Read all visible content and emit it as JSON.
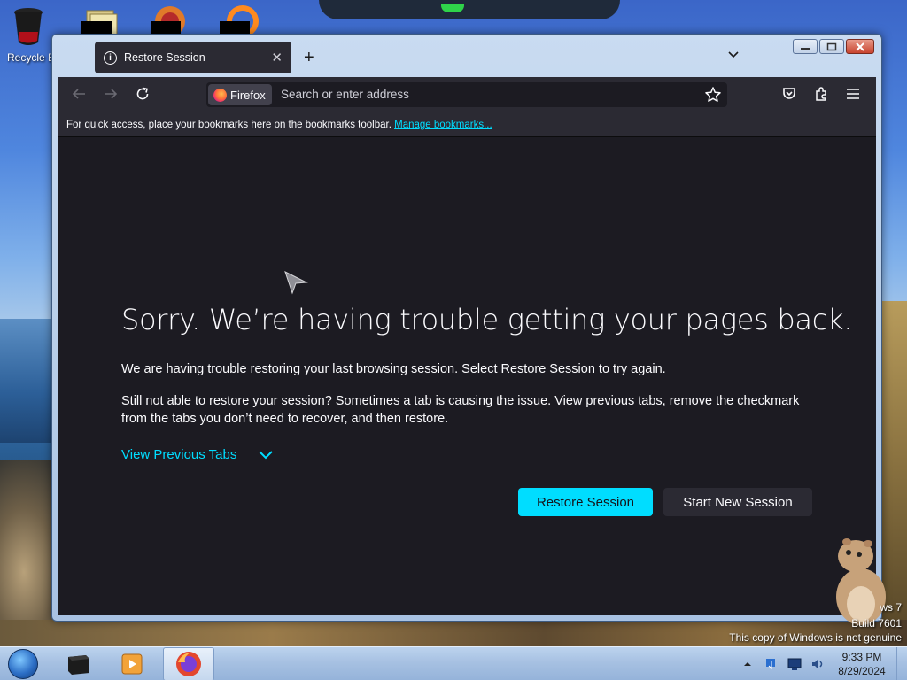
{
  "desktop": {
    "icons": [
      {
        "label": "Recycle B"
      }
    ],
    "watermark": {
      "line1": "ws 7",
      "line2": "Build 7601",
      "line3": "This copy of Windows is not genuine"
    }
  },
  "browser": {
    "tab": {
      "title": "Restore Session",
      "close_glyph": "✕"
    },
    "new_tab_glyph": "+",
    "urlbar": {
      "identity_label": "Firefox",
      "placeholder": "Search or enter address"
    },
    "bookmarks_toolbar": {
      "text": "For quick access, place your bookmarks here on the bookmarks toolbar.",
      "link": "Manage bookmarks..."
    },
    "page": {
      "heading": "Sorry. We’re having trouble getting your pages back.",
      "para1": "We are having trouble restoring your last browsing session. Select Restore Session to try again.",
      "para2": "Still not able to restore your session? Sometimes a tab is causing the issue. View previous tabs, remove the checkmark from the tabs you don’t need to recover, and then restore.",
      "view_previous_tabs": "View Previous Tabs",
      "restore_button": "Restore Session",
      "new_session_button": "Start New Session"
    }
  },
  "taskbar": {
    "clock_time": "9:33 PM",
    "clock_date": "8/29/2024"
  },
  "colors": {
    "accent": "#00ddff",
    "page_bg": "#1c1b22",
    "toolbar_bg": "#2b2a33"
  }
}
